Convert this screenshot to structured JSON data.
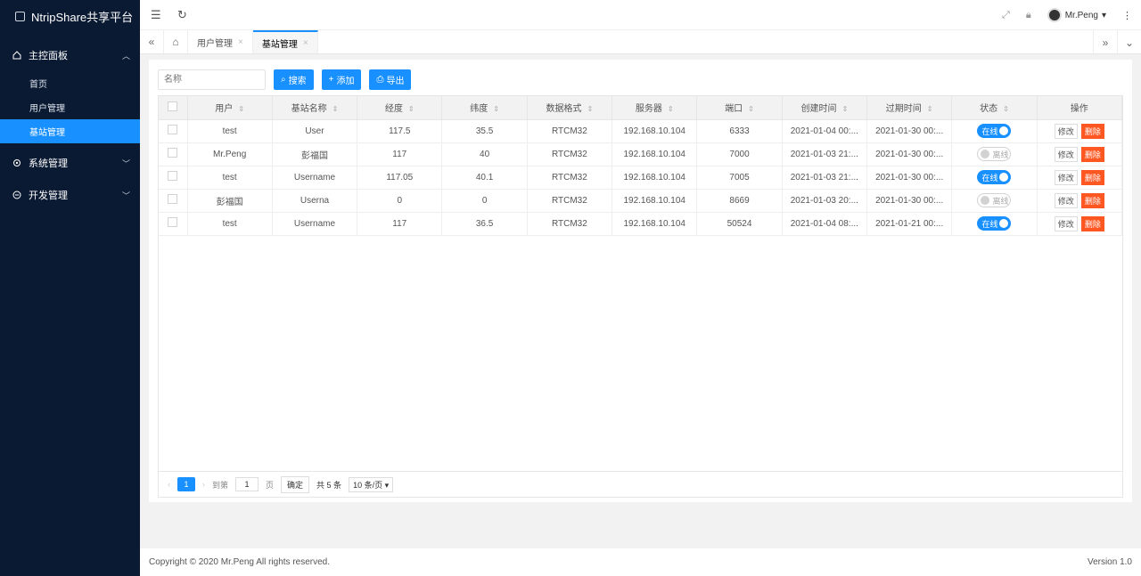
{
  "app": {
    "title": "NtripShare共享平台"
  },
  "sidebar": {
    "groups": [
      {
        "label": "主控面板",
        "items": [
          "首页",
          "用户管理",
          "基站管理"
        ]
      },
      {
        "label": "系统管理"
      },
      {
        "label": "开发管理"
      }
    ],
    "active_item": "基站管理"
  },
  "header": {
    "user": "Mr.Peng"
  },
  "tabs": [
    {
      "label": "用户管理"
    },
    {
      "label": "基站管理",
      "active": true
    }
  ],
  "toolbar": {
    "search_placeholder": "名称",
    "search_label": "搜索",
    "add_label": "添加",
    "export_label": "导出"
  },
  "table": {
    "columns": [
      "用户",
      "基站名称",
      "经度",
      "纬度",
      "数据格式",
      "服务器",
      "端口",
      "创建时间",
      "过期时间",
      "状态",
      "操作"
    ],
    "rows": [
      {
        "user": "test",
        "name": "User",
        "lon": "117.5",
        "lat": "35.5",
        "format": "RTCM32",
        "server": "192.168.10.104",
        "port": "6333",
        "created": "2021-01-04 00:...",
        "expires": "2021-01-30 00:...",
        "status": "在线",
        "online": true
      },
      {
        "user": "Mr.Peng",
        "name": "彭福国",
        "lon": "117",
        "lat": "40",
        "format": "RTCM32",
        "server": "192.168.10.104",
        "port": "7000",
        "created": "2021-01-03 21:...",
        "expires": "2021-01-30 00:...",
        "status": "离线",
        "online": false
      },
      {
        "user": "test",
        "name": "Username",
        "lon": "117.05",
        "lat": "40.1",
        "format": "RTCM32",
        "server": "192.168.10.104",
        "port": "7005",
        "created": "2021-01-03 21:...",
        "expires": "2021-01-30 00:...",
        "status": "在线",
        "online": true
      },
      {
        "user": "彭福国",
        "name": "Userna",
        "lon": "0",
        "lat": "0",
        "format": "RTCM32",
        "server": "192.168.10.104",
        "port": "8669",
        "created": "2021-01-03 20:...",
        "expires": "2021-01-30 00:...",
        "status": "离线",
        "online": false
      },
      {
        "user": "test",
        "name": "Username",
        "lon": "117",
        "lat": "36.5",
        "format": "RTCM32",
        "server": "192.168.10.104",
        "port": "50524",
        "created": "2021-01-04 08:...",
        "expires": "2021-01-21 00:...",
        "status": "在线",
        "online": true
      }
    ],
    "edit_label": "修改",
    "delete_label": "删除"
  },
  "pager": {
    "current": "1",
    "goto_label": "到第",
    "goto_value": "1",
    "page_label": "页",
    "ok_label": "确定",
    "total": "共 5 条",
    "size": "10 条/页"
  },
  "footer": {
    "copyright": "Copyright © 2020 Mr.Peng All rights reserved.",
    "version": "Version 1.0"
  },
  "colors": {
    "sidebar": "#0b1a33",
    "accent": "#1890ff",
    "danger": "#ff5722"
  }
}
